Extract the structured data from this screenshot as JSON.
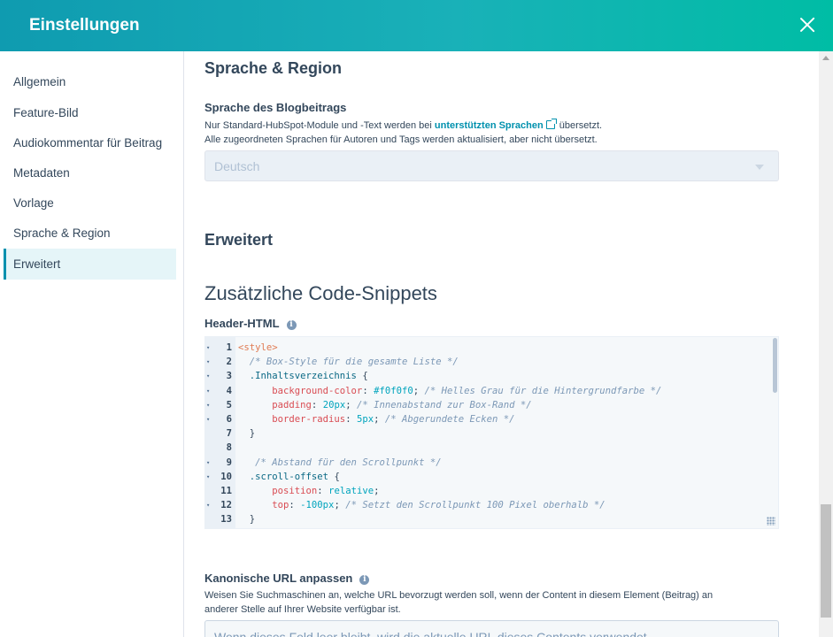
{
  "header": {
    "title": "Einstellungen"
  },
  "sidebar": {
    "items": [
      {
        "label": "Allgemein"
      },
      {
        "label": "Feature-Bild"
      },
      {
        "label": "Audiokommentar für Beitrag"
      },
      {
        "label": "Metadaten"
      },
      {
        "label": "Vorlage"
      },
      {
        "label": "Sprache & Region"
      },
      {
        "label": "Erweitert"
      }
    ],
    "active_index": 6
  },
  "language_section": {
    "title": "Sprache & Region",
    "label": "Sprache des Blogbeitrags",
    "help_pre": "Nur Standard-HubSpot-Module und -Text werden bei ",
    "help_link": "unterstützten Sprachen",
    "help_post": " übersetzt.",
    "help_line2": "Alle zugeordneten Sprachen für Autoren und Tags werden aktualisiert, aber nicht übersetzt.",
    "select_value": "Deutsch"
  },
  "advanced_section": {
    "title": "Erweitert",
    "snippets_title": "Zusätzliche Code-Snippets",
    "header_html_label": "Header-HTML"
  },
  "code_editor": {
    "lines": [
      {
        "n": "1",
        "fold": true,
        "tokens": [
          {
            "t": "<style>",
            "c": "tag"
          }
        ]
      },
      {
        "n": "2",
        "fold": true,
        "tokens": [
          {
            "t": "  /* Box-Style für die gesamte Liste */",
            "c": "comment"
          }
        ]
      },
      {
        "n": "3",
        "fold": true,
        "tokens": [
          {
            "t": "  .Inhaltsverzeichnis",
            "c": "sel"
          },
          {
            "t": " {",
            "c": "plain"
          }
        ]
      },
      {
        "n": "4",
        "fold": true,
        "tokens": [
          {
            "t": "      background-color",
            "c": "prop"
          },
          {
            "t": ": ",
            "c": "plain"
          },
          {
            "t": "#f0f0f0",
            "c": "val"
          },
          {
            "t": "; ",
            "c": "plain"
          },
          {
            "t": "/* Helles Grau für die Hintergrundfarbe */",
            "c": "comment"
          }
        ]
      },
      {
        "n": "5",
        "fold": true,
        "tokens": [
          {
            "t": "      padding",
            "c": "prop"
          },
          {
            "t": ": ",
            "c": "plain"
          },
          {
            "t": "20px",
            "c": "val"
          },
          {
            "t": "; ",
            "c": "plain"
          },
          {
            "t": "/* Innenabstand zur Box-Rand */",
            "c": "comment"
          }
        ]
      },
      {
        "n": "6",
        "fold": true,
        "tokens": [
          {
            "t": "      border-radius",
            "c": "prop"
          },
          {
            "t": ": ",
            "c": "plain"
          },
          {
            "t": "5px",
            "c": "val"
          },
          {
            "t": "; ",
            "c": "plain"
          },
          {
            "t": "/* Abgerundete Ecken */",
            "c": "comment"
          }
        ]
      },
      {
        "n": "7",
        "fold": false,
        "tokens": [
          {
            "t": "  }",
            "c": "plain"
          }
        ]
      },
      {
        "n": "8",
        "fold": false,
        "tokens": [
          {
            "t": "",
            "c": "plain"
          }
        ]
      },
      {
        "n": "9",
        "fold": true,
        "tokens": [
          {
            "t": "   /* Abstand für den Scrollpunkt */",
            "c": "comment"
          }
        ]
      },
      {
        "n": "10",
        "fold": true,
        "tokens": [
          {
            "t": "  .scroll-offset",
            "c": "sel"
          },
          {
            "t": " {",
            "c": "plain"
          }
        ]
      },
      {
        "n": "11",
        "fold": false,
        "tokens": [
          {
            "t": "      position",
            "c": "prop"
          },
          {
            "t": ": ",
            "c": "plain"
          },
          {
            "t": "relative",
            "c": "val"
          },
          {
            "t": ";",
            "c": "plain"
          }
        ]
      },
      {
        "n": "12",
        "fold": true,
        "tokens": [
          {
            "t": "      top",
            "c": "prop"
          },
          {
            "t": ": ",
            "c": "plain"
          },
          {
            "t": "-100px",
            "c": "val"
          },
          {
            "t": "; ",
            "c": "plain"
          },
          {
            "t": "/* Setzt den Scrollpunkt 100 Pixel oberhalb */",
            "c": "comment"
          }
        ]
      },
      {
        "n": "13",
        "fold": false,
        "tokens": [
          {
            "t": "  }",
            "c": "plain"
          }
        ]
      }
    ]
  },
  "canonical_section": {
    "label": "Kanonische URL anpassen",
    "help_line1": "Weisen Sie Suchmaschinen an, welche URL bevorzugt werden soll, wenn der Content in diesem Element (Beitrag) an",
    "help_line2": "anderer Stelle auf Ihrer Website verfügbar ist.",
    "placeholder": "Wenn dieses Feld leer bleibt, wird die aktuelle URL dieses Contents verwendet."
  },
  "colors": {
    "accent": "#0091ae",
    "header_gradient_start": "#0f9bb0",
    "header_gradient_end": "#00bda5"
  }
}
